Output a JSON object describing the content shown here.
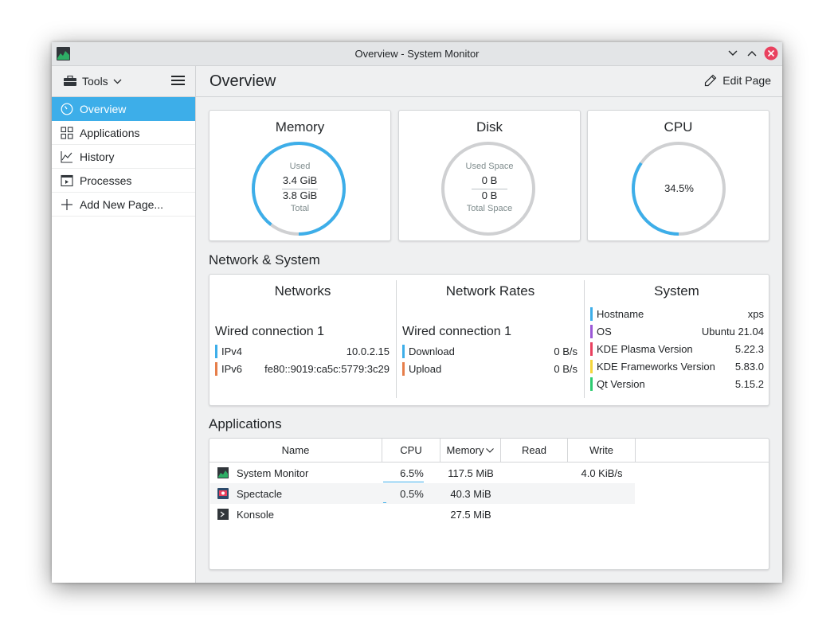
{
  "window": {
    "title": "Overview - System Monitor"
  },
  "sidebar": {
    "tools_label": "Tools",
    "items": [
      {
        "label": "Overview",
        "icon": "speedometer-icon",
        "active": true
      },
      {
        "label": "Applications",
        "icon": "grid-icon",
        "active": false
      },
      {
        "label": "History",
        "icon": "chart-icon",
        "active": false
      },
      {
        "label": "Processes",
        "icon": "process-icon",
        "active": false
      },
      {
        "label": "Add New Page...",
        "icon": "plus-icon",
        "active": false
      }
    ]
  },
  "header": {
    "title": "Overview",
    "edit_label": "Edit Page"
  },
  "memory": {
    "title": "Memory",
    "used_label": "Used",
    "used": "3.4 GiB",
    "total": "3.8 GiB",
    "total_label": "Total",
    "fraction": 0.895
  },
  "disk": {
    "title": "Disk",
    "used_label": "Used Space",
    "used": "0 B",
    "total": "0 B",
    "total_label": "Total Space",
    "fraction": 0
  },
  "cpu": {
    "title": "CPU",
    "value": "34.5%",
    "fraction": 0.345
  },
  "network_system": {
    "section_title": "Network & System",
    "networks": {
      "title": "Networks",
      "connection": "Wired connection 1",
      "rows": [
        {
          "key": "IPv4",
          "value": "10.0.2.15",
          "color": "#3daee9"
        },
        {
          "key": "IPv6",
          "value": "fe80::9019:ca5c:5779:3c29",
          "color": "#e67e4a"
        }
      ]
    },
    "rates": {
      "title": "Network Rates",
      "connection": "Wired connection 1",
      "rows": [
        {
          "key": "Download",
          "value": "0 B/s",
          "color": "#3daee9"
        },
        {
          "key": "Upload",
          "value": "0 B/s",
          "color": "#e67e4a"
        }
      ]
    },
    "system": {
      "title": "System",
      "rows": [
        {
          "key": "Hostname",
          "value": "xps",
          "color": "#3daee9"
        },
        {
          "key": "OS",
          "value": "Ubuntu 21.04",
          "color": "#9b59d6"
        },
        {
          "key": "KDE Plasma Version",
          "value": "5.22.3",
          "color": "#e9415f"
        },
        {
          "key": "KDE Frameworks Version",
          "value": "5.83.0",
          "color": "#f4d53b"
        },
        {
          "key": "Qt Version",
          "value": "5.15.2",
          "color": "#2ecc71"
        }
      ]
    }
  },
  "applications": {
    "section_title": "Applications",
    "columns": [
      "Name",
      "CPU",
      "Memory",
      "Read",
      "Write"
    ],
    "rows": [
      {
        "name": "System Monitor",
        "icon": "system-monitor-icon",
        "cpu": "6.5%",
        "cpu_fraction": 0.065,
        "memory": "117.5 MiB",
        "read": "",
        "write": "4.0 KiB/s"
      },
      {
        "name": "Spectacle",
        "icon": "spectacle-icon",
        "cpu": "0.5%",
        "cpu_fraction": 0.005,
        "memory": "40.3 MiB",
        "read": "",
        "write": ""
      },
      {
        "name": "Konsole",
        "icon": "konsole-icon",
        "cpu": "",
        "cpu_fraction": 0,
        "memory": "27.5 MiB",
        "read": "",
        "write": ""
      }
    ]
  }
}
